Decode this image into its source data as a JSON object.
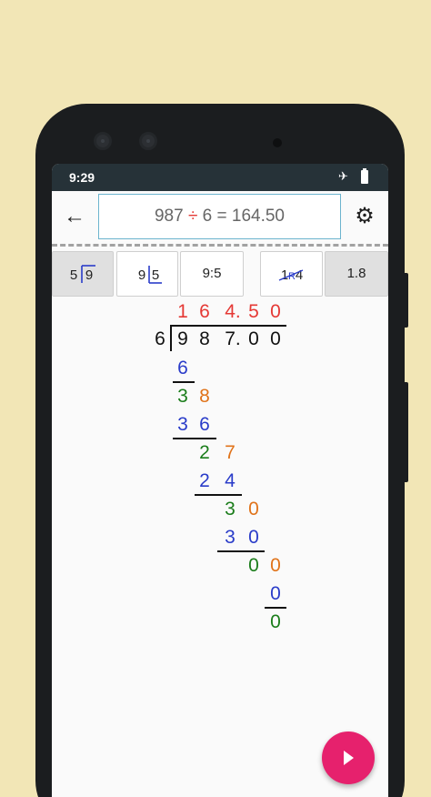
{
  "status": {
    "time": "9:29",
    "airplane_icon": "✈"
  },
  "appbar": {
    "back_icon": "←",
    "expression_left": "987 ",
    "expression_op": "÷",
    "expression_right": " 6 = 164.50",
    "settings_icon": "⚙"
  },
  "modes": [
    {
      "a": "5",
      "b": "9",
      "selected": true
    },
    {
      "a": "9",
      "b": "5",
      "selected": false
    },
    {
      "label": "9:5",
      "selected": false
    },
    {
      "a": "1",
      "r": "R",
      "b": "4",
      "selected": false
    },
    {
      "label": "1.8",
      "selected": true
    }
  ],
  "division": {
    "quotient": [
      "1",
      "6",
      "4.",
      "5",
      "0"
    ],
    "divisor": "6",
    "dividend": [
      "9",
      "8",
      "7.",
      "0",
      "0"
    ],
    "steps": [
      [
        "6"
      ],
      [
        "3",
        "8"
      ],
      [
        "3",
        "6"
      ],
      [
        "2",
        "7"
      ],
      [
        "2",
        "4"
      ],
      [
        "3",
        "0"
      ],
      [
        "3",
        "0"
      ],
      [
        "0",
        "0"
      ],
      [
        "0"
      ],
      [
        "0"
      ]
    ]
  },
  "colors": {
    "quotient": "#e53935",
    "product": "#2a3cc9",
    "remainder": "#1b7d1b",
    "brought_down": "#e0731a",
    "fab": "#e6216d"
  }
}
